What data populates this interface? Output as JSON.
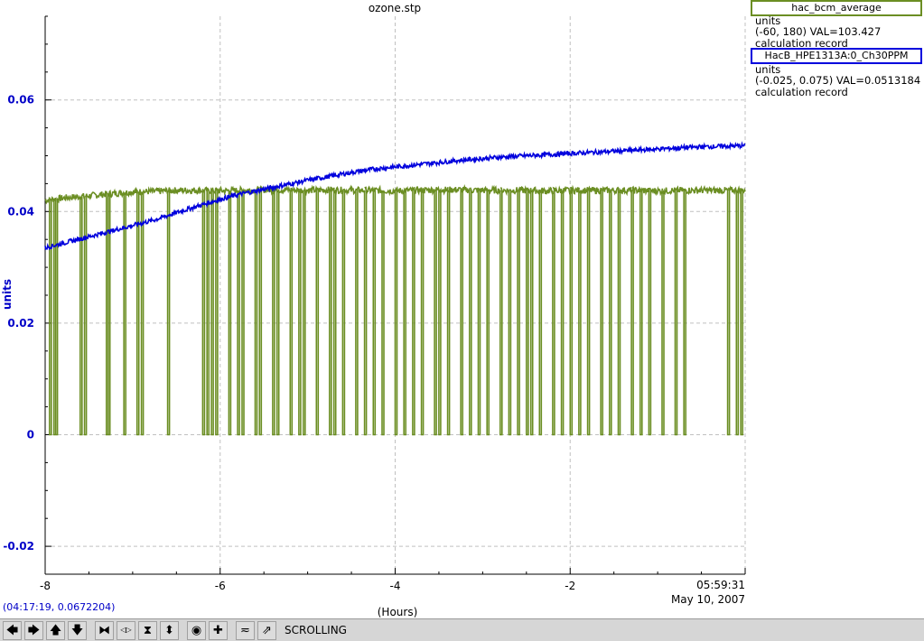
{
  "title": "ozone.stp",
  "xlabel": "(Hours)",
  "ylabel": "units",
  "timestamp": {
    "time": "05:59:31",
    "date": "May 10, 2007"
  },
  "cursor_readout": "(04:17:19, 0.0672204)",
  "legend": [
    {
      "name": "hac_bcm_average",
      "units": "units",
      "range_val": "(-60, 180) VAL=103.427",
      "note": "calculation record",
      "color": "#6b8e23"
    },
    {
      "name": "HacB_HPE1313A:0_Ch30PPM",
      "units": "units",
      "range_val": "(-0.025, 0.075) VAL=0.0513184",
      "note": "calculation record",
      "color": "#0000dd"
    }
  ],
  "toolbar": {
    "buttons": [
      {
        "name": "scroll-left-button",
        "icon": "arrow-left-icon",
        "glyph": "🡄"
      },
      {
        "name": "scroll-right-button",
        "icon": "arrow-right-icon",
        "glyph": "🡆"
      },
      {
        "name": "scroll-up-button",
        "icon": "arrow-up-icon",
        "glyph": "🡅"
      },
      {
        "name": "scroll-down-button",
        "icon": "arrow-down-icon",
        "glyph": "🡇"
      },
      {
        "name": "compress-x-button",
        "icon": "compress-horizontal-icon",
        "glyph": "⧓"
      },
      {
        "name": "expand-x-button",
        "icon": "expand-horizontal-icon",
        "glyph": "◁▷"
      },
      {
        "name": "compress-y-button",
        "icon": "compress-vertical-icon",
        "glyph": "⧗"
      },
      {
        "name": "expand-y-button",
        "icon": "expand-vertical-icon",
        "glyph": "⬍"
      },
      {
        "name": "reset-button",
        "icon": "circle-target-icon",
        "glyph": "◉"
      },
      {
        "name": "add-trace-button",
        "icon": "plus-icon",
        "glyph": "✚"
      },
      {
        "name": "autoscale-button",
        "icon": "autoscale-icon",
        "glyph": "≂"
      },
      {
        "name": "stagger-button",
        "icon": "stagger-arrow-icon",
        "glyph": "⇗"
      }
    ],
    "mode_label": "SCROLLING"
  },
  "chart_data": {
    "type": "line",
    "title": "ozone.stp",
    "xlabel": "(Hours)",
    "ylabel": "units",
    "xlim": [
      -8,
      0
    ],
    "ylim": [
      -0.025,
      0.075
    ],
    "x_ticks": [
      -8,
      -6,
      -4,
      -2
    ],
    "y_ticks": [
      -0.02,
      0,
      0.02,
      0.04,
      0.06
    ],
    "y_tick_labels": [
      "-0.02",
      "0",
      "0.02",
      "0.04",
      "0.06"
    ],
    "x_tick_labels": [
      "-8",
      "-6",
      "-4",
      "-2"
    ],
    "grid": true,
    "series": [
      {
        "name": "HacB_HPE1313A:0_Ch30PPM",
        "color": "#0000dd",
        "x": [
          -8,
          -7.75,
          -7.5,
          -7.25,
          -7,
          -6.75,
          -6.5,
          -6.25,
          -6,
          -5.75,
          -5.5,
          -5.25,
          -5,
          -4.75,
          -4.5,
          -4.25,
          -4,
          -3.75,
          -3.5,
          -3.25,
          -3,
          -2.75,
          -2.5,
          -2.25,
          -2,
          -1.75,
          -1.5,
          -1.25,
          -1,
          -0.75,
          -0.5,
          -0.25,
          0
        ],
        "y": [
          0.0335,
          0.0345,
          0.0355,
          0.0365,
          0.0375,
          0.0385,
          0.0398,
          0.041,
          0.0422,
          0.0432,
          0.044,
          0.0448,
          0.0456,
          0.0463,
          0.047,
          0.0476,
          0.048,
          0.0484,
          0.0488,
          0.0492,
          0.0495,
          0.0498,
          0.05,
          0.0502,
          0.0504,
          0.0506,
          0.0508,
          0.051,
          0.0512,
          0.0514,
          0.0516,
          0.0517,
          0.0518
        ]
      },
      {
        "name": "hac_bcm_average",
        "color": "#6b8e23",
        "baseline": 0.0425,
        "x": [
          -8,
          -7.75,
          -7.5,
          -7.25,
          -7,
          -6.75,
          -6.5,
          -6.25,
          -6,
          -5.75,
          -5.5,
          -5.25,
          -5,
          -4.75,
          -4.5,
          -4.25,
          -4,
          -3.75,
          -3.5,
          -3.25,
          -3,
          -2.75,
          -2.5,
          -2.25,
          -2,
          -1.75,
          -1.5,
          -1.25,
          -1,
          -0.75,
          -0.5,
          -0.25,
          0
        ],
        "y": [
          0.042,
          0.0425,
          0.0428,
          0.0432,
          0.0435,
          0.0436,
          0.0438,
          0.0438,
          0.0437,
          0.0438,
          0.0439,
          0.0439,
          0.0438,
          0.0439,
          0.0438,
          0.0438,
          0.0437,
          0.0438,
          0.0439,
          0.0439,
          0.0438,
          0.0438,
          0.0438,
          0.0437,
          0.0438,
          0.0438,
          0.0438,
          0.0438,
          0.0437,
          0.0438,
          0.0438,
          0.0438,
          0.0438
        ],
        "dropouts_x": [
          -7.95,
          -7.9,
          -7.88,
          -7.6,
          -7.55,
          -7.3,
          -7.28,
          -7.1,
          -6.95,
          -6.9,
          -6.6,
          -6.2,
          -6.15,
          -6.1,
          -6.05,
          -5.9,
          -5.8,
          -5.75,
          -5.6,
          -5.55,
          -5.4,
          -5.35,
          -5.2,
          -5.1,
          -5.05,
          -4.9,
          -4.75,
          -4.7,
          -4.6,
          -4.45,
          -4.35,
          -4.25,
          -4.15,
          -4.0,
          -3.9,
          -3.8,
          -3.7,
          -3.55,
          -3.5,
          -3.4,
          -3.25,
          -3.15,
          -3.05,
          -2.95,
          -2.8,
          -2.7,
          -2.6,
          -2.5,
          -2.45,
          -2.35,
          -2.2,
          -2.1,
          -2.0,
          -1.9,
          -1.8,
          -1.65,
          -1.55,
          -1.45,
          -1.3,
          -1.2,
          -1.1,
          -0.95,
          -0.8,
          -0.7,
          -0.2,
          -0.1,
          -0.05
        ],
        "dropout_min": 0
      }
    ],
    "legend_position": "right"
  }
}
